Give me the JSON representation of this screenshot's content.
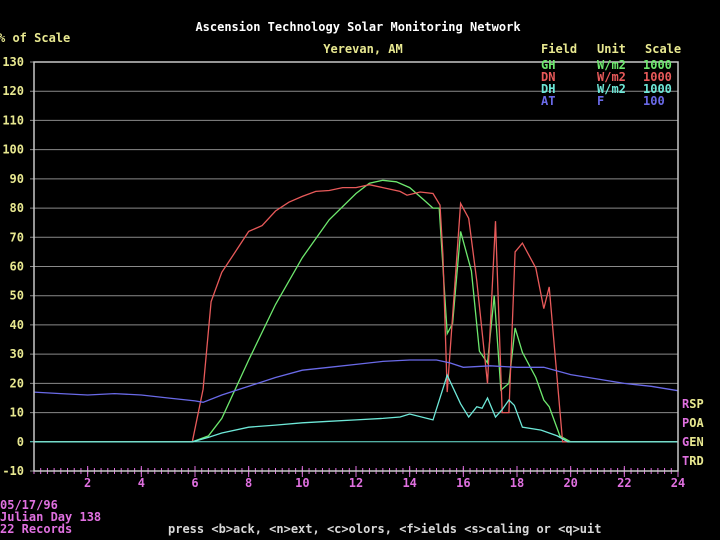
{
  "header": {
    "title": "Ascension Technology Solar Monitoring Network",
    "subtitle": "Yerevan, AM",
    "ylabel": "% of Scale"
  },
  "legend": {
    "headers": [
      "Field",
      "Unit",
      "Scale"
    ],
    "rows": [
      {
        "field": "GH",
        "unit": "W/m2",
        "scale": "1000",
        "color": "#6ee86e"
      },
      {
        "field": "DN",
        "unit": "W/m2",
        "scale": "1000",
        "color": "#e85a5a"
      },
      {
        "field": "DH",
        "unit": "W/m2",
        "scale": "1000",
        "color": "#6ee8d8"
      },
      {
        "field": "AT",
        "unit": "F",
        "scale": "100",
        "color": "#6a6ae8"
      }
    ]
  },
  "side_labels": [
    "RSP",
    "POA",
    "GEN",
    "TRD"
  ],
  "footer": {
    "date": "05/17/96",
    "julian": "Julian Day 138",
    "records": "22 Records",
    "prompt": "press <b>ack, <n>ext, <c>olors, <f>ields <s>caling or <q>uit"
  },
  "colors": {
    "background": "#000000",
    "axis_labels": "#e070e0",
    "y_labels": "#e8e890",
    "grid": "#9a9a9a",
    "title": "#ffffff"
  },
  "chart_data": {
    "type": "line",
    "xlim": [
      0,
      24
    ],
    "ylim": [
      -10,
      130
    ],
    "xticks": [
      "2",
      "4",
      "6",
      "8",
      "10",
      "12",
      "14",
      "16",
      "18",
      "20",
      "22",
      "24"
    ],
    "yticks": [
      "130",
      "120",
      "110",
      "100",
      "90",
      "80",
      "70",
      "60",
      "50",
      "40",
      "30",
      "20",
      "10",
      "0",
      "-10"
    ],
    "grid": true,
    "legend_position": "top-right",
    "series": [
      {
        "name": "GH",
        "color": "#6ee86e",
        "points": [
          [
            0,
            0
          ],
          [
            5.9,
            0
          ],
          [
            6.5,
            2
          ],
          [
            7,
            8
          ],
          [
            8,
            28
          ],
          [
            9,
            47
          ],
          [
            10,
            63
          ],
          [
            11,
            76
          ],
          [
            12,
            85
          ],
          [
            12.5,
            88.5
          ],
          [
            13,
            89.5
          ],
          [
            13.5,
            89
          ],
          [
            14,
            87
          ],
          [
            14.5,
            83
          ],
          [
            14.87,
            80
          ],
          [
            15.1,
            80
          ],
          [
            15.4,
            37
          ],
          [
            15.6,
            40.5
          ],
          [
            15.9,
            72
          ],
          [
            16.3,
            58.5
          ],
          [
            16.6,
            31
          ],
          [
            16.9,
            27
          ],
          [
            17.15,
            50
          ],
          [
            17.4,
            17.7
          ],
          [
            17.7,
            20
          ],
          [
            17.93,
            39
          ],
          [
            18.2,
            30.6
          ],
          [
            18.7,
            22
          ],
          [
            19,
            14.3
          ],
          [
            19.2,
            12
          ],
          [
            19.6,
            2
          ],
          [
            20,
            0
          ],
          [
            24,
            0
          ]
        ]
      },
      {
        "name": "DN",
        "color": "#e85a5a",
        "points": [
          [
            0,
            0
          ],
          [
            5.9,
            0
          ],
          [
            6.3,
            18
          ],
          [
            6.6,
            48
          ],
          [
            7,
            58
          ],
          [
            7.5,
            65
          ],
          [
            8,
            72
          ],
          [
            8.5,
            74
          ],
          [
            9,
            79
          ],
          [
            9.5,
            82
          ],
          [
            10,
            84
          ],
          [
            10.5,
            85.7
          ],
          [
            11,
            86
          ],
          [
            11.5,
            87
          ],
          [
            12,
            87
          ],
          [
            12.5,
            88
          ],
          [
            13,
            87
          ],
          [
            13.64,
            85.7
          ],
          [
            13.9,
            84.4
          ],
          [
            14.39,
            85.5
          ],
          [
            14.87,
            85
          ],
          [
            15.13,
            81
          ],
          [
            15.24,
            64
          ],
          [
            15.4,
            17
          ],
          [
            15.9,
            81.6
          ],
          [
            16.2,
            76.5
          ],
          [
            16.5,
            55
          ],
          [
            16.9,
            20
          ],
          [
            17.2,
            75.5
          ],
          [
            17.45,
            10
          ],
          [
            17.7,
            10
          ],
          [
            17.93,
            65
          ],
          [
            18.2,
            68
          ],
          [
            18.7,
            59.5
          ],
          [
            19,
            45.6
          ],
          [
            19.2,
            53
          ],
          [
            19.7,
            0
          ],
          [
            24,
            0
          ]
        ]
      },
      {
        "name": "DH",
        "color": "#6ee8d8",
        "points": [
          [
            0,
            0
          ],
          [
            5.9,
            0
          ],
          [
            6.5,
            1.5
          ],
          [
            7,
            3
          ],
          [
            8,
            5
          ],
          [
            9,
            5.7
          ],
          [
            10,
            6.5
          ],
          [
            11,
            7
          ],
          [
            12,
            7.5
          ],
          [
            13,
            8
          ],
          [
            13.64,
            8.5
          ],
          [
            14,
            9.5
          ],
          [
            14.87,
            7.5
          ],
          [
            15.4,
            22.8
          ],
          [
            15.9,
            13
          ],
          [
            16.2,
            8.5
          ],
          [
            16.5,
            12
          ],
          [
            16.7,
            11.5
          ],
          [
            16.9,
            15
          ],
          [
            17.2,
            8.5
          ],
          [
            17.45,
            11
          ],
          [
            17.7,
            14.3
          ],
          [
            17.9,
            12.5
          ],
          [
            18.2,
            5
          ],
          [
            18.9,
            4
          ],
          [
            19.5,
            2
          ],
          [
            19.9,
            0
          ],
          [
            24,
            0
          ]
        ]
      },
      {
        "name": "AT",
        "color": "#6a6ae8",
        "points": [
          [
            0,
            17
          ],
          [
            1,
            16.5
          ],
          [
            2,
            16
          ],
          [
            3,
            16.5
          ],
          [
            4,
            16
          ],
          [
            5,
            15
          ],
          [
            6,
            14
          ],
          [
            6.3,
            13.5
          ],
          [
            7,
            16
          ],
          [
            8,
            19
          ],
          [
            9,
            22
          ],
          [
            10,
            24.5
          ],
          [
            11,
            25.5
          ],
          [
            12,
            26.5
          ],
          [
            13,
            27.5
          ],
          [
            14,
            28
          ],
          [
            15,
            28
          ],
          [
            15.5,
            27
          ],
          [
            16,
            25.5
          ],
          [
            17,
            26
          ],
          [
            18,
            25.5
          ],
          [
            19,
            25.5
          ],
          [
            20,
            23
          ],
          [
            21,
            21.5
          ],
          [
            22,
            20
          ],
          [
            23,
            19
          ],
          [
            24,
            17.5
          ]
        ]
      }
    ]
  }
}
